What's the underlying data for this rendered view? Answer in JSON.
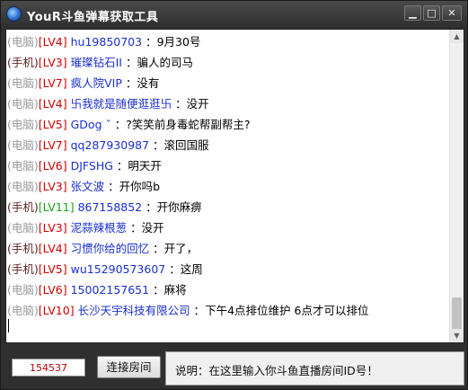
{
  "window": {
    "title": "YouR斗鱼弹幕获取工具",
    "controls": {
      "minimize": "▁",
      "maximize": "□",
      "close": "✕"
    }
  },
  "chat": {
    "messages": [
      {
        "source": "(电脑)",
        "level": "[LV4]",
        "nick": "hu19850703",
        "sep": " ：",
        "text": "9月30号",
        "source_type": "pc",
        "level_color": "red"
      },
      {
        "source": "(手机)",
        "level": "[LV3]",
        "nick": "璀璨钻石II",
        "sep": " ：",
        "text": "骗人的司马",
        "source_type": "mobile",
        "level_color": "red"
      },
      {
        "source": "(电脑)",
        "level": "[LV7]",
        "nick": "疯人院VIP",
        "sep": " ：",
        "text": "没有",
        "source_type": "pc",
        "level_color": "red"
      },
      {
        "source": "(电脑)",
        "level": "[LV4]",
        "nick": "卐我就是随便逛逛卐",
        "sep": " ：",
        "text": "没开",
        "source_type": "pc",
        "level_color": "red"
      },
      {
        "source": "(电脑)",
        "level": "[LV5]",
        "nick": "GDog ˇ",
        "sep": " ：",
        "text": "?笑笑前身毒蛇帮副帮主?",
        "source_type": "pc",
        "level_color": "red"
      },
      {
        "source": "(电脑)",
        "level": "[LV7]",
        "nick": "qq287930987",
        "sep": " ：",
        "text": "滚回国服",
        "source_type": "pc",
        "level_color": "red"
      },
      {
        "source": "(电脑)",
        "level": "[LV6]",
        "nick": "DJFSHG",
        "sep": " ：",
        "text": "明天开",
        "source_type": "pc",
        "level_color": "red"
      },
      {
        "source": "(电脑)",
        "level": "[LV3]",
        "nick": "张文波",
        "sep": " ：",
        "text": "开你吗b",
        "source_type": "pc",
        "level_color": "red"
      },
      {
        "source": "(手机)",
        "level": "[LV11]",
        "nick": "867158852",
        "sep": " ：",
        "text": "开你麻痹",
        "source_type": "mobile",
        "level_color": "green"
      },
      {
        "source": "(电脑)",
        "level": "[LV3]",
        "nick": "泥蒜辣根葱",
        "sep": " ：",
        "text": "没开",
        "source_type": "pc",
        "level_color": "red"
      },
      {
        "source": "(手机)",
        "level": "[LV4]",
        "nick": "习惯你给的回忆",
        "sep": " ：",
        "text": "开了，",
        "source_type": "mobile",
        "level_color": "red"
      },
      {
        "source": "(手机)",
        "level": "[LV5]",
        "nick": "wu15290573607",
        "sep": " ：",
        "text": "这周",
        "source_type": "mobile",
        "level_color": "red"
      },
      {
        "source": "(电脑)",
        "level": "[LV6]",
        "nick": "15002157651",
        "sep": " ：",
        "text": "麻将",
        "source_type": "pc",
        "level_color": "red"
      },
      {
        "source": "(电脑)",
        "level": "[LV10]",
        "nick": "长沙天宇科技有限公司",
        "sep": " ：",
        "text": "下午4点排位维护 6点才可以排位",
        "source_type": "pc",
        "level_color": "red"
      }
    ]
  },
  "controls": {
    "room_id_value": "154537",
    "connect_label": "连接房间",
    "hint": "说明：在这里输入你斗鱼直播房间ID号！"
  },
  "colors": {
    "source_pc": "#9a9a9a",
    "source_mobile": "#5b1f1f",
    "level_red": "#d20000",
    "level_green": "#19a219",
    "nick": "#1a2fd0",
    "room_id_text": "#c00000"
  },
  "icons": {
    "app": "douyu-app-icon",
    "scroll_up": "▲",
    "scroll_down": "▼"
  }
}
